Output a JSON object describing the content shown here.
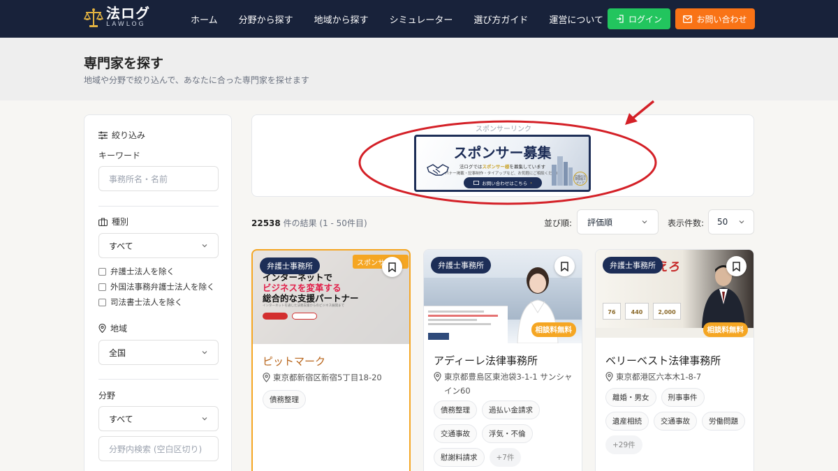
{
  "header": {
    "logo_main": "法ログ",
    "logo_sub": "LAWLOG",
    "nav": [
      "ホーム",
      "分野から探す",
      "地域から探す",
      "シミュレーター",
      "選び方ガイド",
      "運営について"
    ],
    "login_label": "ログイン",
    "contact_label": "お問い合わせ",
    "colors": {
      "bg": "#18223a",
      "login": "#22c55e",
      "contact": "#f97316"
    }
  },
  "page": {
    "title": "専門家を探す",
    "subtitle": "地域や分野で絞り込んで、あなたに合った専門家を探せます"
  },
  "sidebar": {
    "filter_heading": "絞り込み",
    "keyword_label": "キーワード",
    "keyword_placeholder": "事務所名・名前",
    "type_label": "種別",
    "type_value": "すべて",
    "checkboxes": [
      "弁護士法人を除く",
      "外国法事務弁護士法人を除く",
      "司法書士法人を除く"
    ],
    "region_label": "地域",
    "region_value": "全国",
    "field_label": "分野",
    "field_value": "すべて",
    "field_search_placeholder": "分野内検索 (空白区切り)"
  },
  "sponsor": {
    "label": "スポンサーリンク",
    "banner_title": "スポンサー募集",
    "banner_line1_pre": "法ログでは",
    "banner_line1_hl": "スポンサー様",
    "banner_line1_post": "を募集しています",
    "banner_line2": "バナー掲載・記事制作・タイアップなど、お気軽にご相談ください",
    "banner_button": "お問い合わせはこちら",
    "badge_text": "信頼の法律情報メディア",
    "highlight_color": "#d42027"
  },
  "results": {
    "count": "22538",
    "count_suffix": "件の結果 (1 - 50件目)",
    "sort_label": "並び順:",
    "sort_value": "評価順",
    "per_page_label": "表示件数:",
    "per_page_value": "50"
  },
  "cards": [
    {
      "type": "弁護士事務所",
      "sponsor_tag": "スポンサー",
      "image_text": [
        "インターネットで",
        "ビジネスを変革する",
        "総合的な支援パートナー"
      ],
      "image_small": "インターネットを通じた法務支援からのビジネス展開まで",
      "name": "ピットマーク",
      "address": "東京都新宿区新宿5丁目18-20",
      "tags": [
        "債務整理"
      ]
    },
    {
      "type": "弁護士事務所",
      "free_tag": "相談料無料",
      "name": "アディーレ法律事務所",
      "address": "東京都豊島区東池袋3-1-1 サンシャイン60",
      "tags": [
        "債務整理",
        "過払い金請求",
        "交通事故",
        "浮気・不倫",
        "慰謝料請求"
      ],
      "more": "+7件"
    },
    {
      "type": "弁護士事務所",
      "free_tag": "相談料無料",
      "image_red": "えろ",
      "image_stats": [
        "76",
        "440",
        "2,000"
      ],
      "name": "ベリーベスト法律事務所",
      "address": "東京都港区六本木1-8-7",
      "tags": [
        "離婚・男女",
        "刑事事件",
        "遺産相続",
        "交通事故",
        "労働問題"
      ],
      "more": "+29件"
    }
  ]
}
